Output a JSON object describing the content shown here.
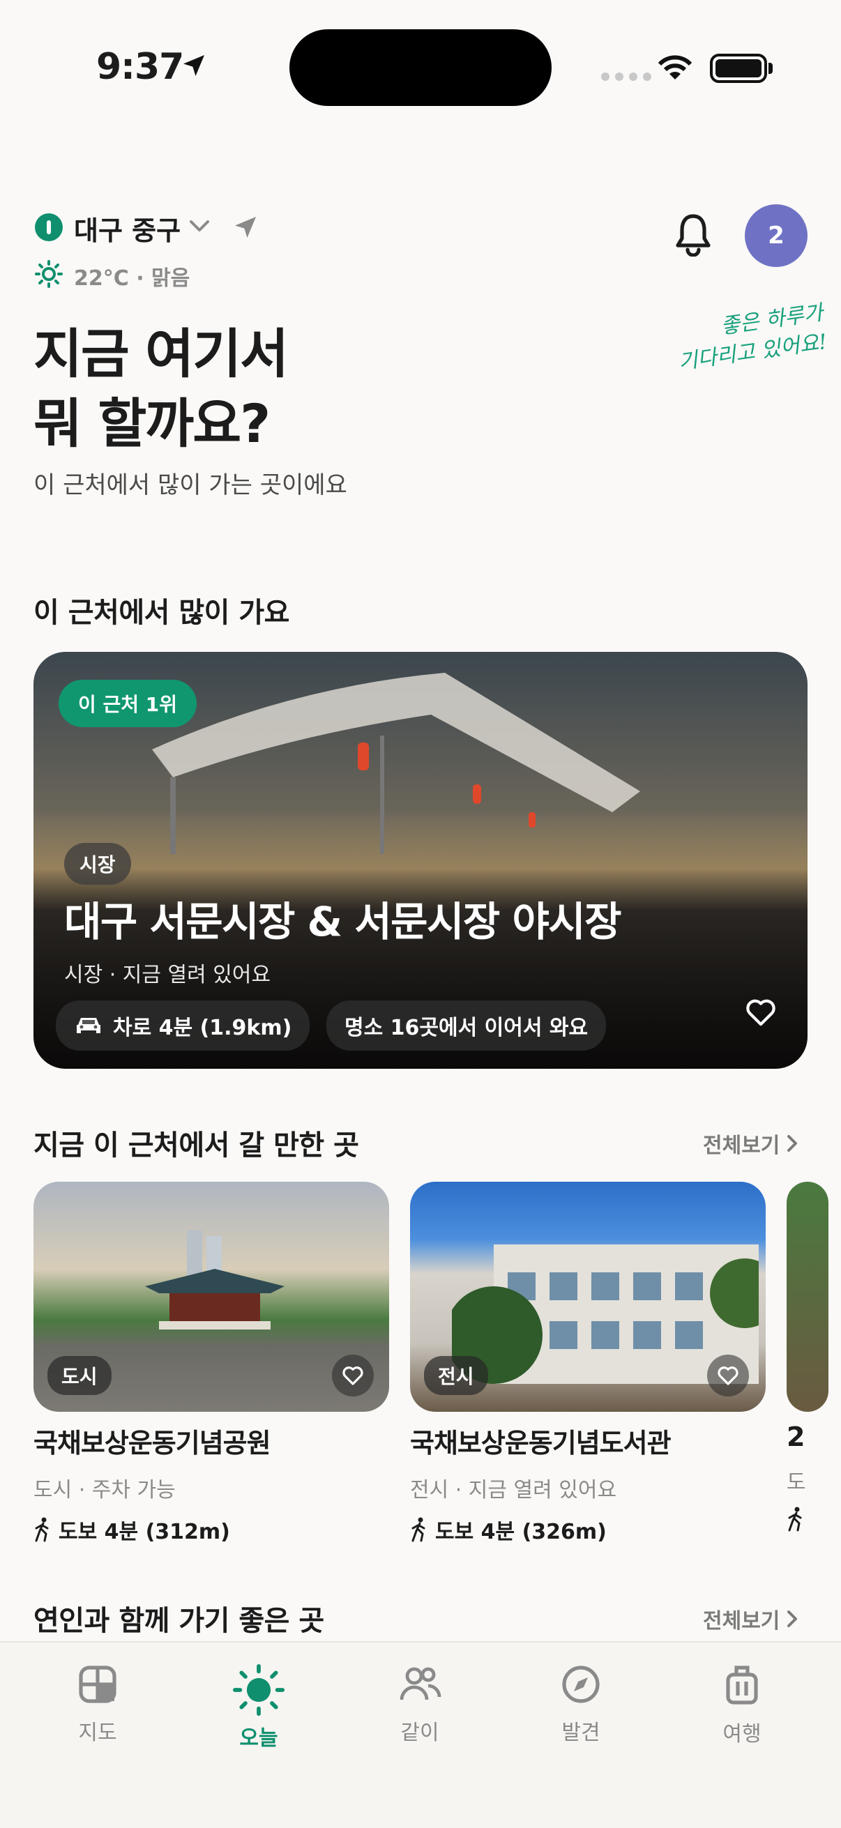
{
  "status": {
    "time": "9:37"
  },
  "header": {
    "location": "대구 중구",
    "weather": "22°C · 맑음",
    "notification_count": "2",
    "title": "지금 여기서\n뭐 할까요?",
    "subtitle": "이 근처에서 많이 가는 곳이에요",
    "tagline": "좋은 하루가\n기다리고 있어요!"
  },
  "popular": {
    "section_title": "이 근처에서 많이 가요",
    "rank_badge": "이 근처 1위",
    "category": "시장",
    "title": "대구 서문시장 & 서문시장 야시장",
    "subtitle": "시장 · 지금 열려 있어요",
    "drive_chip": "차로 4분 (1.9km)",
    "linked_chip": "명소 16곳에서 이어서 와요"
  },
  "nearby": {
    "section_title": "지금 이 근처에서 갈 만한 곳",
    "see_all": "전체보기",
    "places": [
      {
        "category": "도시",
        "name": "국채보상운동기념공원",
        "sub": "도시 · 주차 가능",
        "walk": "도보 4분 (312m)"
      },
      {
        "category": "전시",
        "name": "국채보상운동기념도서관",
        "sub": "전시 · 지금 열려 있어요",
        "walk": "도보 4분 (326m)"
      },
      {
        "name": "2",
        "sub": "도"
      }
    ]
  },
  "couple": {
    "section_title": "연인과 함께 가기 좋은 곳",
    "see_all": "전체보기"
  },
  "tabs": [
    {
      "label": "지도",
      "icon": "map-grid-icon"
    },
    {
      "label": "오늘",
      "icon": "sun-icon",
      "active": true
    },
    {
      "label": "같이",
      "icon": "people-icon"
    },
    {
      "label": "발견",
      "icon": "compass-icon"
    },
    {
      "label": "여행",
      "icon": "luggage-icon"
    }
  ],
  "colors": {
    "accent": "#0f8f6e",
    "avatar": "#6f72c4",
    "background": "#faf9f7"
  }
}
